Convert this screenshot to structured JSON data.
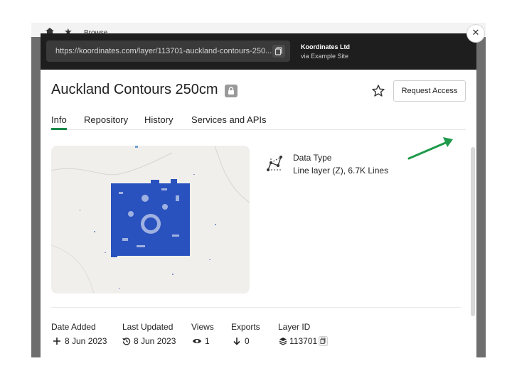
{
  "background_page": {
    "tab_label": "Browse"
  },
  "header": {
    "url": "https://koordinates.com/layer/113701-auckland-contours-250...",
    "org_name": "Koordinates Ltd",
    "org_via": "via Example Site"
  },
  "layer": {
    "title": "Auckland Contours 250cm",
    "request_access_label": "Request Access"
  },
  "tabs": [
    {
      "label": "Info",
      "active": true
    },
    {
      "label": "Repository"
    },
    {
      "label": "History"
    },
    {
      "label": "Services and APIs"
    }
  ],
  "data_type": {
    "title": "Data Type",
    "value": "Line layer (Z), 6.7K Lines"
  },
  "metadata": {
    "date_added_label": "Date Added",
    "date_added_value": "8 Jun 2023",
    "last_updated_label": "Last Updated",
    "last_updated_value": "8 Jun 2023",
    "views_label": "Views",
    "views_value": "1",
    "exports_label": "Exports",
    "exports_value": "0",
    "layer_id_label": "Layer ID",
    "layer_id_value": "113701"
  },
  "icons": [
    "home-icon",
    "star-icon",
    "copy-icon",
    "lock-icon",
    "close-icon",
    "line-layer-icon",
    "plus-icon",
    "history-icon",
    "eye-icon",
    "download-arrow-icon",
    "layers-icon"
  ],
  "colors": {
    "header_bg": "#1e1e1e",
    "accent_green": "#1a8a4a",
    "contour_blue": "#2a52be",
    "annotation_arrow": "#1e9a4a"
  }
}
